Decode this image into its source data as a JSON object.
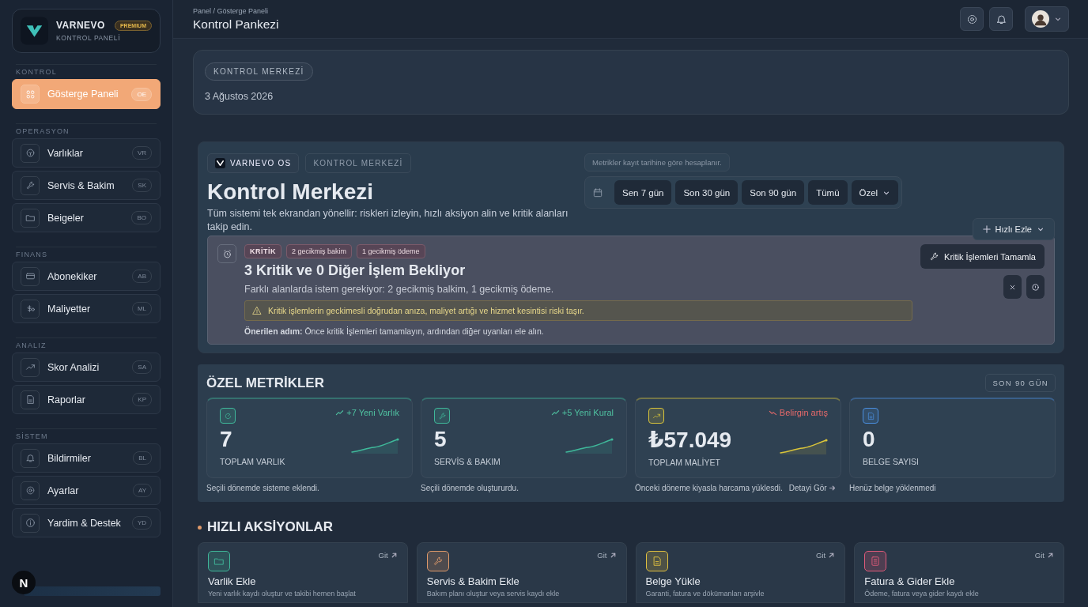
{
  "brand": {
    "name": "VARNEVO",
    "badge": "PREMIUM",
    "subtitle": "KONTROL PANELİ"
  },
  "sidebar": [
    {
      "title": "KONTROL",
      "items": [
        {
          "label": "Gösterge Paneli",
          "shortcut": "OE",
          "selected": true
        }
      ]
    },
    {
      "title": "OPERASYON",
      "items": [
        {
          "label": "Varlıklar",
          "shortcut": "VR",
          "selected": false
        },
        {
          "label": "Servis & Bakim",
          "shortcut": "SK",
          "selected": false
        },
        {
          "label": "Beigeler",
          "shortcut": "BO",
          "selected": false
        }
      ]
    },
    {
      "title": "FINANS",
      "items": [
        {
          "label": "Abonekiker",
          "shortcut": "AB",
          "selected": false
        },
        {
          "label": "Maliyetter",
          "shortcut": "ML",
          "selected": false
        }
      ]
    },
    {
      "title": "ANALIZ",
      "items": [
        {
          "label": "Skor Analizi",
          "shortcut": "SA",
          "selected": false
        },
        {
          "label": "Raporlar",
          "shortcut": "KP",
          "selected": false
        }
      ]
    },
    {
      "title": "SİSTEM",
      "items": [
        {
          "label": "Bildirmiler",
          "shortcut": "BL",
          "selected": false
        },
        {
          "label": "Ayarlar",
          "shortcut": "AY",
          "selected": false
        },
        {
          "label": "Yardim & Destek",
          "shortcut": "YD",
          "selected": false
        }
      ]
    }
  ],
  "dev_badge": "N",
  "header": {
    "breadcrumb": "Panel / Gösterge Paneli",
    "title": "Kontrol Pankezi"
  },
  "hero": {
    "chip": "KONTROL MERKEZİ",
    "date": "3 Ağustos 2026"
  },
  "command": {
    "tags": [
      {
        "label": "VARNEVO OS",
        "kind": "brand"
      },
      {
        "label": "KONTROL MERKEZİ",
        "kind": "plain"
      }
    ],
    "title": "Kontrol Merkezi",
    "description": "Tüm sistemi tek ekrandan yönellir: riskleri izleyin, hızlı aksiyon alin ve kritik alanları takip edin.",
    "note": "Metrikler kayıt tarihine göre hesaplanır.",
    "ranges": [
      {
        "label": "Sen 7 gün",
        "kind": "option"
      },
      {
        "label": "Son 30 gün",
        "kind": "option"
      },
      {
        "label": "Son 90 gün",
        "kind": "option"
      },
      {
        "label": "Tümü",
        "kind": "option"
      },
      {
        "label": "Özel",
        "kind": "dropdown"
      }
    ],
    "quick_button": "Hızlı Ezle"
  },
  "alert": {
    "badges": [
      {
        "label": "KRİTİK",
        "kind": "critical"
      },
      {
        "label": "2 gecikmiş bakim",
        "kind": "count"
      },
      {
        "label": "1 gecikmiş ödeme",
        "kind": "count"
      }
    ],
    "title": "3 Kritik ve 0 Diğer İşlem Bekliyor",
    "description": "Farklı alanlarda istem gerekiyor: 2 gecikmiş balkim, 1 gecikmiş ödeme.",
    "warning": "Kritik işlemlerin geckimesli doğrudan anıza, maliyet artığı ve hizmet kesintisi riski taşır.",
    "recommendation": "**Önerilen adım:** Önce kritik İşlemleri tamamlayın, ardından diğer uyanları ele alın.",
    "action": "Kritik İşlemleri Tamamla"
  },
  "metrics": {
    "title": "ÖZEL METRİKLER",
    "period": "SON 90 GÜN",
    "cards": [
      {
        "color": "#3fb89a",
        "trend": "+7 Yeni Varlık",
        "warning": false,
        "value": "7",
        "label": "TOPLAM VARLIK",
        "note": "Seçili dönemde sisteme eklendi.",
        "sparkline": true
      },
      {
        "color": "#3fb89a",
        "trend": "+5 Yeni Kural",
        "warning": false,
        "value": "5",
        "label": "SERVİS & BAKIM",
        "note": "Seçili dönemde oluştururdu.",
        "sparkline": true
      },
      {
        "color": "#d9c43a",
        "trend": "Belirgin artış",
        "warning": true,
        "value": "₺57.049",
        "label": "TOPLAM MALİYET",
        "note": "Önceki döneme kiyasla harcama yüklesdi.",
        "link": "Detayi Gör",
        "sparkline": true
      },
      {
        "color": "#4a8fe0",
        "value": "0",
        "label": "BELGE SAYISI",
        "note": "Henüz belge yöklenmedi",
        "sparkline": false
      }
    ]
  },
  "actions": {
    "title": "HIZLI AKSİYONLAR",
    "cards": [
      {
        "color": "#3fb89a",
        "link": "Git",
        "title": "Varlik Ekle",
        "description": "Yeni varlık kaydı oluştur ve takibi hemen başlat"
      },
      {
        "color": "#e09a6a",
        "link": "Git",
        "title": "Servis & Bakim Ekle",
        "description": "Bakım planı oluştur veya servis kaydı ekle"
      },
      {
        "color": "#e0c040",
        "link": "Git",
        "title": "Belge Yükle",
        "description": "Garanti, fatura ve dökümanları arşivle"
      },
      {
        "color": "#e05a7a",
        "link": "Git",
        "title": "Fatura & Gider Ekle",
        "description": "Ödeme, fatura veya gider kaydı ekle"
      }
    ]
  }
}
